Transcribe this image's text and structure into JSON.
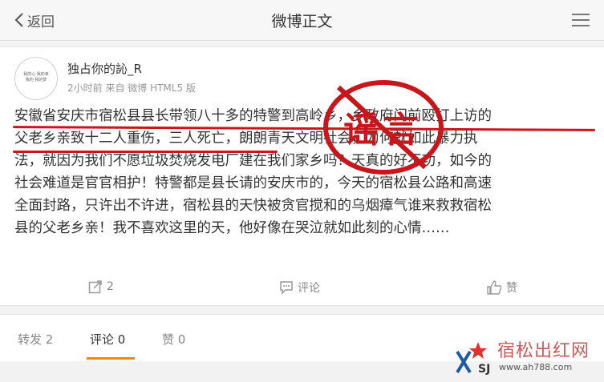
{
  "nav": {
    "back_label": "返回",
    "title": "微博正文"
  },
  "post": {
    "avatar_text": "我的心 我的幸 我的 我的梦",
    "username": "独占你的訫_R",
    "meta": "2小时前 来自 微博 HTML5 版",
    "lines": [
      "安徽省安庆市宿松县县长带领八十多的特警到高岭乡，乡政府门前殴打上访的",
      "父老乡亲致十二人重伤，三人死亡，朗朗青天文明社会，为何就如此暴力执",
      "法，就因为我们不愿垃圾焚烧发电厂建在我们家乡吗？天真的好不功，如今的",
      "社会难道是官官相护！特警都是县长请的安庆市的，今天的宿松县公路和高速",
      "全面封路，只许出不许进，宿松县的天快被贪官搅和的乌烟瘴气谁来救救宿松",
      "县的父老乡亲！我不喜欢这里的天，他好像在哭泣就如此刻的心情……"
    ],
    "stamp_text": "谣言"
  },
  "actions": {
    "repost_count": "2",
    "comment_label": "评论",
    "like_label": "赞"
  },
  "tabs": [
    {
      "label": "转发",
      "count": "2"
    },
    {
      "label": "评论",
      "count": "0"
    },
    {
      "label": "赞",
      "count": "0"
    }
  ],
  "watermark": {
    "site": "宿松出红网",
    "url": "www.ah788.com",
    "logo_text": "SJ"
  },
  "colors": {
    "stamp_red": "#c8161d",
    "tab_accent": "#f08a00"
  }
}
